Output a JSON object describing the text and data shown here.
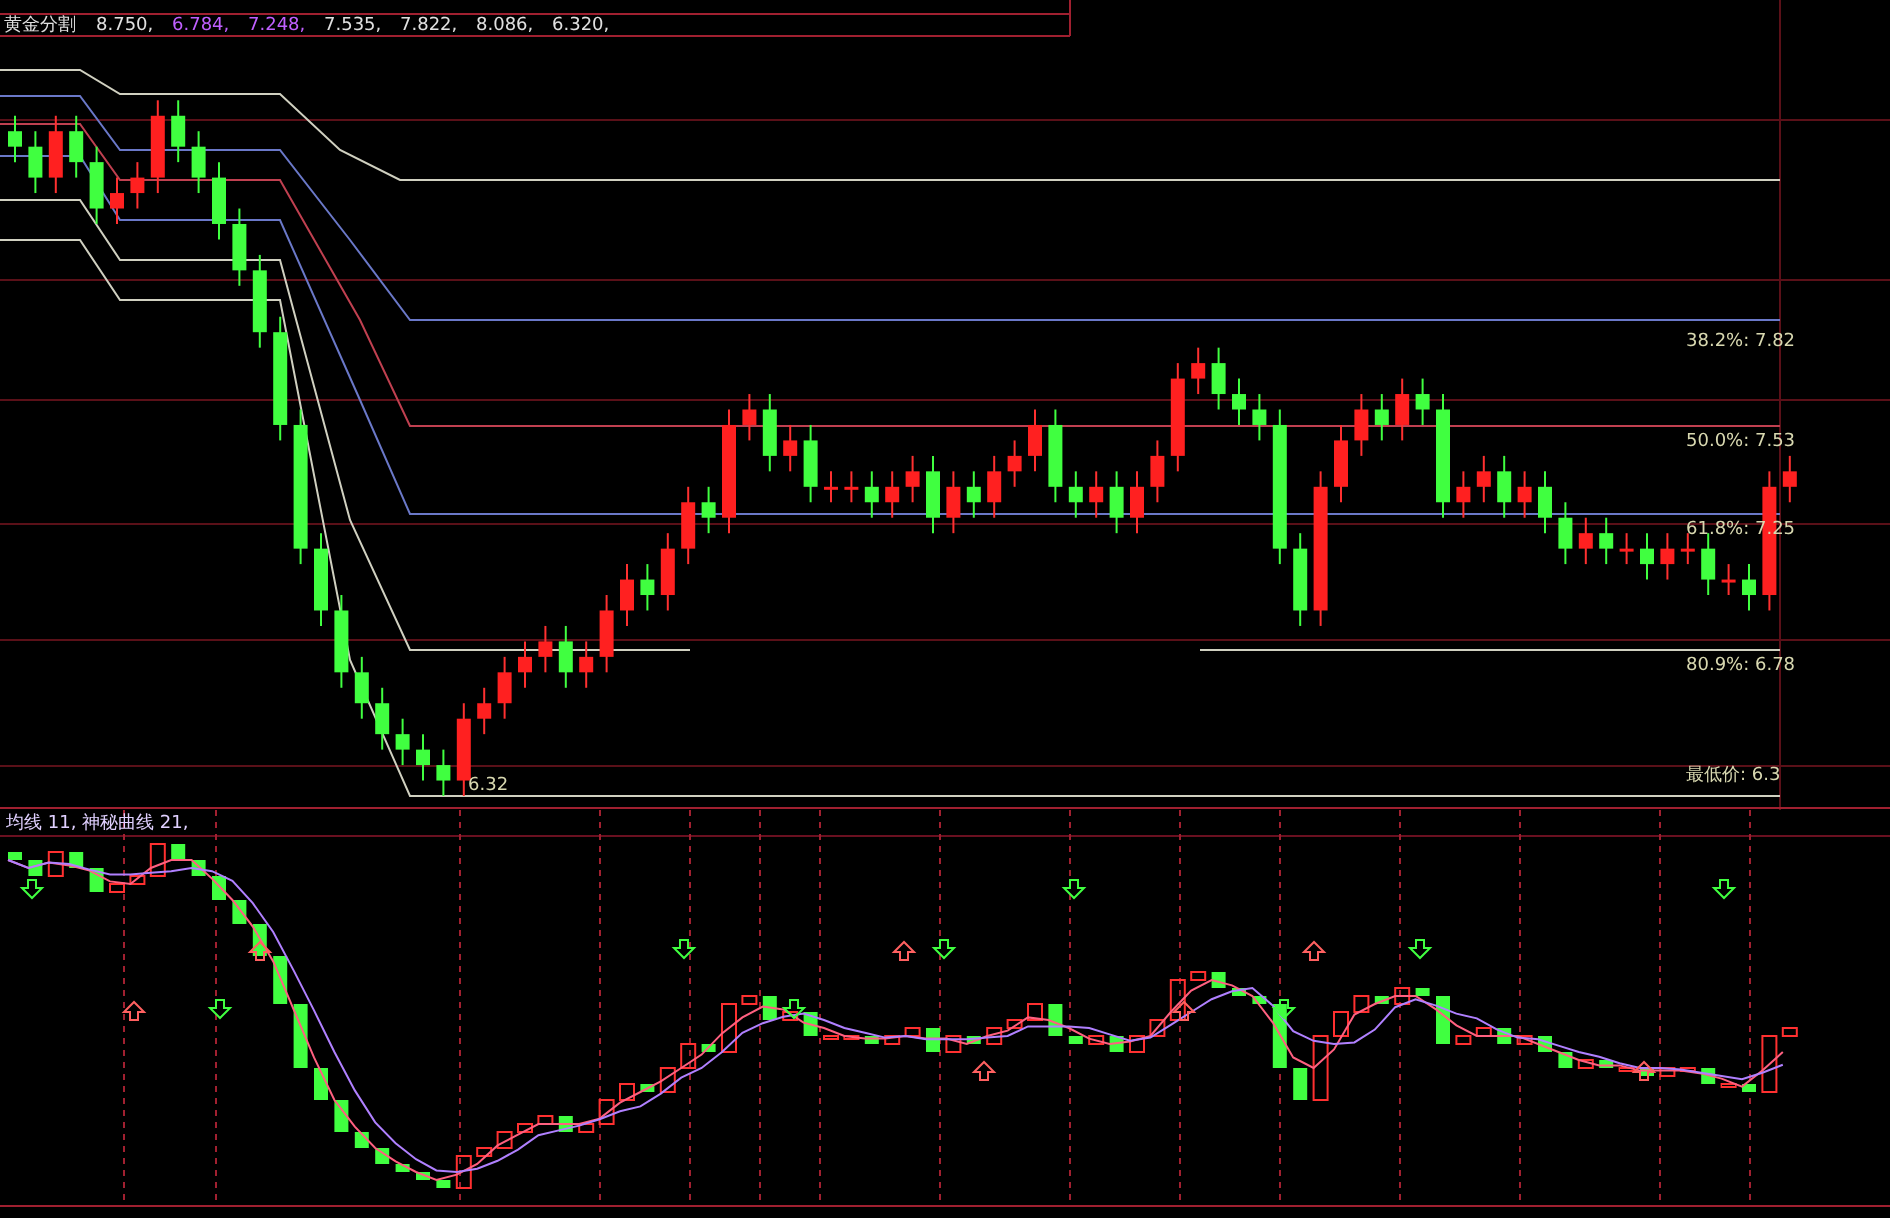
{
  "main_panel": {
    "indicator_name": "黄金分割",
    "indicator_values": [
      {
        "text": "8.750,",
        "color": "#e0e0e0"
      },
      {
        "text": "6.784,",
        "color": "#c060ff"
      },
      {
        "text": "7.248,",
        "color": "#c060ff"
      },
      {
        "text": "7.535,",
        "color": "#e0e0e0"
      },
      {
        "text": "7.822,",
        "color": "#e0e0e0"
      },
      {
        "text": "8.086,",
        "color": "#e0e0e0"
      },
      {
        "text": "6.320,",
        "color": "#e0e0e0"
      }
    ],
    "level_labels": [
      "38.2%: 7.82",
      "50.0%: 7.53",
      "61.8%: 7.25",
      "80.9%: 6.78",
      "最低价: 6.3"
    ],
    "low_marker": "6.32"
  },
  "sub_panel": {
    "legend": "均线 11, 神秘曲线 21,"
  }
}
